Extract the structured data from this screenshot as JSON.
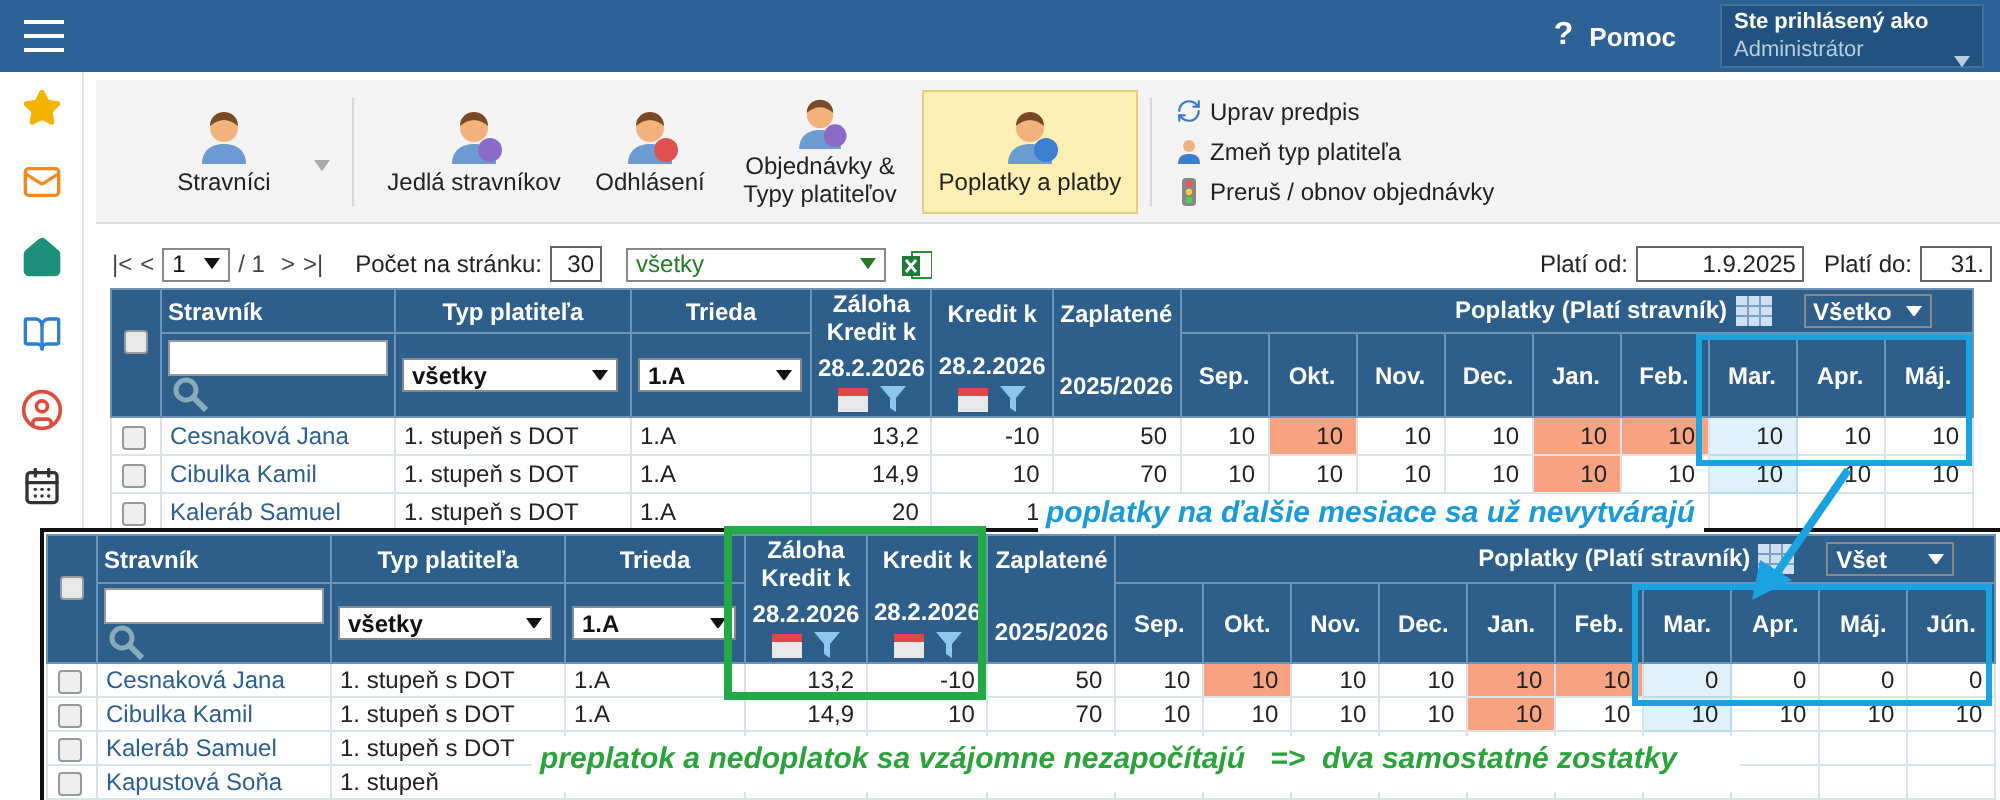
{
  "header": {
    "help_mark": "?",
    "help": "Pomoc",
    "user_label": "Ste prihlásený ako",
    "user": "Administrátor"
  },
  "toolbar": {
    "buttons": [
      {
        "label": "Stravníci",
        "selected": false
      },
      {
        "label": "Jedlá stravníkov",
        "selected": false
      },
      {
        "label": "Odhlásení",
        "selected": false
      },
      {
        "label": "Objednávky &\nTypy platiteľov",
        "selected": false
      },
      {
        "label": "Poplatky a platby",
        "selected": true
      }
    ],
    "actions": [
      "Uprav predpis",
      "Zmeň typ platiteľa",
      "Preruš / obnov objednávky"
    ]
  },
  "pager": {
    "first": "|<",
    "prev": "<",
    "page": "1",
    "total": "/ 1",
    "next": ">",
    "last": ">|",
    "per_page_label": "Počet na stránku:",
    "per_page": "30",
    "filter": "všetky"
  },
  "validity": {
    "from_label": "Platí od:",
    "from": "1.9.2025",
    "to_label": "Platí do:",
    "to": "31."
  },
  "table": {
    "all_checked": false,
    "columns": {
      "name": "Stravník",
      "type": "Typ platiteľa",
      "class": "Trieda",
      "deposit": "Záloha Kredit k",
      "deposit_date": "28.2.2026",
      "credit": "Kredit k",
      "credit_date": "28.2.2026",
      "paid": "Zaplatené",
      "paid_year": "2025/2026",
      "fees": "Poplatky (Platí stravník)",
      "fees_filter": "Všetko"
    },
    "filters": {
      "type": "všetky",
      "class": "1.A"
    },
    "months": [
      "Sep.",
      "Okt.",
      "Nov.",
      "Dec.",
      "Jan.",
      "Feb.",
      "Mar.",
      "Apr.",
      "Máj."
    ],
    "rows": [
      {
        "checked": false,
        "name": "Cesnaková Jana",
        "type": "1. stupeň  s DOT",
        "class": "1.A",
        "deposit": "13,2",
        "credit": "-10",
        "paid": "50",
        "months": [
          {
            "value": "10",
            "overdue": false,
            "current": false
          },
          {
            "value": "10",
            "overdue": true,
            "current": false
          },
          {
            "value": "10",
            "overdue": false,
            "current": false
          },
          {
            "value": "10",
            "overdue": false,
            "current": false
          },
          {
            "value": "10",
            "overdue": true,
            "current": false
          },
          {
            "value": "10",
            "overdue": true,
            "current": false
          },
          {
            "value": "10",
            "overdue": false,
            "current": true
          },
          {
            "value": "10",
            "overdue": false,
            "current": false
          },
          {
            "value": "10",
            "overdue": false,
            "current": false
          }
        ]
      },
      {
        "checked": false,
        "name": "Cibulka Kamil",
        "type": "1. stupeň  s DOT",
        "class": "1.A",
        "deposit": "14,9",
        "credit": "10",
        "paid": "70",
        "months": [
          {
            "value": "10",
            "overdue": false,
            "current": false
          },
          {
            "value": "10",
            "overdue": false,
            "current": false
          },
          {
            "value": "10",
            "overdue": false,
            "current": false
          },
          {
            "value": "10",
            "overdue": false,
            "current": false
          },
          {
            "value": "10",
            "overdue": true,
            "current": false
          },
          {
            "value": "10",
            "overdue": false,
            "current": false
          },
          {
            "value": "10",
            "overdue": false,
            "current": true
          },
          {
            "value": "10",
            "overdue": false,
            "current": false
          },
          {
            "value": "10",
            "overdue": false,
            "current": false
          }
        ]
      },
      {
        "checked": false,
        "name": "Kaleráb Samuel",
        "type": "1. stupeň  s DOT",
        "class": "1.A",
        "deposit": "20",
        "credit": "1",
        "months": []
      }
    ]
  },
  "overlay_table": {
    "all_checked": false,
    "columns": {
      "name": "Stravník",
      "type": "Typ platiteľa",
      "class": "Trieda",
      "deposit": "Záloha Kredit k",
      "deposit_date": "28.2.2026",
      "credit": "Kredit k",
      "credit_date": "28.2.2026",
      "paid": "Zaplatené",
      "paid_year": "2025/2026",
      "fees": "Poplatky (Platí stravník)",
      "fees_filter": "Všet"
    },
    "filters": {
      "type": "všetky",
      "class": "1.A"
    },
    "months": [
      "Sep.",
      "Okt.",
      "Nov.",
      "Dec.",
      "Jan.",
      "Feb.",
      "Mar.",
      "Apr.",
      "Máj.",
      "Jún."
    ],
    "rows": [
      {
        "checked": false,
        "name": "Cesnaková Jana",
        "type": "1. stupeň  s DOT",
        "class": "1.A",
        "deposit": "13,2",
        "credit": "-10",
        "paid": "50",
        "months": [
          {
            "value": "10",
            "overdue": false,
            "current": false
          },
          {
            "value": "10",
            "overdue": true,
            "current": false
          },
          {
            "value": "10",
            "overdue": false,
            "current": false
          },
          {
            "value": "10",
            "overdue": false,
            "current": false
          },
          {
            "value": "10",
            "overdue": true,
            "current": false
          },
          {
            "value": "10",
            "overdue": true,
            "current": false
          },
          {
            "value": "0",
            "overdue": false,
            "current": true
          },
          {
            "value": "0",
            "overdue": false,
            "current": false
          },
          {
            "value": "0",
            "overdue": false,
            "current": false
          },
          {
            "value": "0",
            "overdue": false,
            "current": false
          }
        ]
      },
      {
        "checked": false,
        "name": "Cibulka Kamil",
        "type": "1. stupeň  s DOT",
        "class": "1.A",
        "deposit": "14,9",
        "credit": "10",
        "paid": "70",
        "months": [
          {
            "value": "10",
            "overdue": false,
            "current": false
          },
          {
            "value": "10",
            "overdue": false,
            "current": false
          },
          {
            "value": "10",
            "overdue": false,
            "current": false
          },
          {
            "value": "10",
            "overdue": false,
            "current": false
          },
          {
            "value": "10",
            "overdue": true,
            "current": false
          },
          {
            "value": "10",
            "overdue": false,
            "current": false
          },
          {
            "value": "10",
            "overdue": false,
            "current": true
          },
          {
            "value": "10",
            "overdue": false,
            "current": false
          },
          {
            "value": "10",
            "overdue": false,
            "current": false
          },
          {
            "value": "10",
            "overdue": false,
            "current": false
          }
        ]
      },
      {
        "checked": false,
        "name": "Kaleráb Samuel",
        "type": "1. stupeň  s DOT",
        "months": []
      },
      {
        "checked": false,
        "name": "Kapustová Soňa",
        "type": "1. stupeň",
        "months": []
      }
    ]
  },
  "notes": [
    {
      "kind": "fees",
      "text": "poplatky na ďalšie mesiace sa už nevytvárajú"
    },
    {
      "kind": "balance",
      "text": "preplatok a nedoplatok sa vzájomne nezapočítajú   =>  dva samostatné zostatky"
    }
  ]
}
